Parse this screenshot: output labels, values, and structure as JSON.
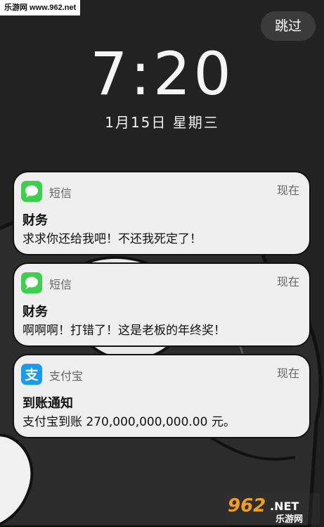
{
  "watermark": "乐游网 www.962.net",
  "skip_label": "跳过",
  "clock": "7:20",
  "date": "1月15日  星期三",
  "notifications": [
    {
      "app": "短信",
      "time": "现在",
      "title": "财务",
      "body": "求求你还给我吧！不还我死定了！",
      "icon": "message-icon",
      "icon_color": "#3fcf4f"
    },
    {
      "app": "短信",
      "time": "现在",
      "title": "财务",
      "body": "啊啊啊！打错了！这是老板的年终奖！",
      "icon": "message-icon",
      "icon_color": "#3fcf4f"
    },
    {
      "app": "支付宝",
      "time": "现在",
      "title": "到账通知",
      "body": "支付宝到账 270,000,000,000.00 元。",
      "icon": "alipay-icon",
      "icon_color": "#1a9bef"
    }
  ],
  "logo": {
    "number": "962",
    "net": ".NET",
    "text": "乐游网"
  }
}
